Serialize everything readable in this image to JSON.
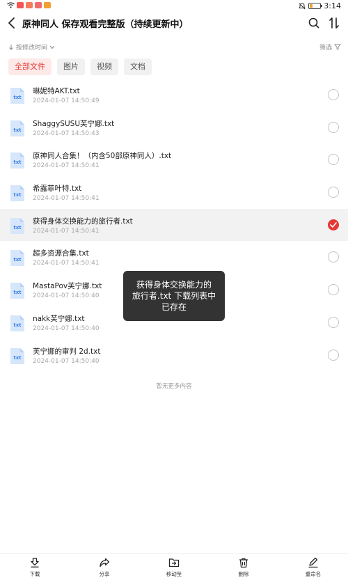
{
  "status_bar": {
    "time": "3:14"
  },
  "header": {
    "title": "原神同人  保存观看完整版（持续更新中）"
  },
  "sort": {
    "label": "按修改时间"
  },
  "filter": {
    "label": "筛选"
  },
  "tabs": [
    {
      "label": "全部文件",
      "active": true
    },
    {
      "label": "图片",
      "active": false
    },
    {
      "label": "视频",
      "active": false
    },
    {
      "label": "文档",
      "active": false
    }
  ],
  "file_icon_label": "txt",
  "files": [
    {
      "name": "琳妮特AKT.txt",
      "date": "2024-01-07 14:50:49",
      "selected": false
    },
    {
      "name": "ShaggySUSU芙宁娜.txt",
      "date": "2024-01-07 14:50:43",
      "selected": false
    },
    {
      "name": "原神同人合集！（内含50部原神同人）.txt",
      "date": "2024-01-07 14:50:41",
      "selected": false
    },
    {
      "name": "希露菲叶特.txt",
      "date": "2024-01-07 14:50:41",
      "selected": false
    },
    {
      "name": "获得身体交换能力的旅行者.txt",
      "date": "2024-01-07 14:50:41",
      "selected": true
    },
    {
      "name": "超多资源合集.txt",
      "date": "2024-01-07 14:50:41",
      "selected": false
    },
    {
      "name": "MastaPov芙宁娜.txt",
      "date": "2024-01-07 14:50:40",
      "selected": false
    },
    {
      "name": "nakk芙宁娜.txt",
      "date": "2024-01-07 14:50:40",
      "selected": false
    },
    {
      "name": "芙宁娜的审判 2d.txt",
      "date": "2024-01-07 14:50:40",
      "selected": false
    }
  ],
  "list_footer": "暂无更多内容",
  "toast": {
    "line1": "获得身体交换能力的",
    "line2": "旅行者.txt 下载列表中",
    "line3": "已存在"
  },
  "bottom_bar": {
    "download": "下载",
    "share": "分享",
    "move": "移动至",
    "delete": "删除",
    "rename": "重命名"
  },
  "colors": {
    "accent": "#e53935",
    "file_icon": "#3b82e6",
    "file_icon_bg": "#d6e6fb",
    "toast_bg": "#333333"
  }
}
